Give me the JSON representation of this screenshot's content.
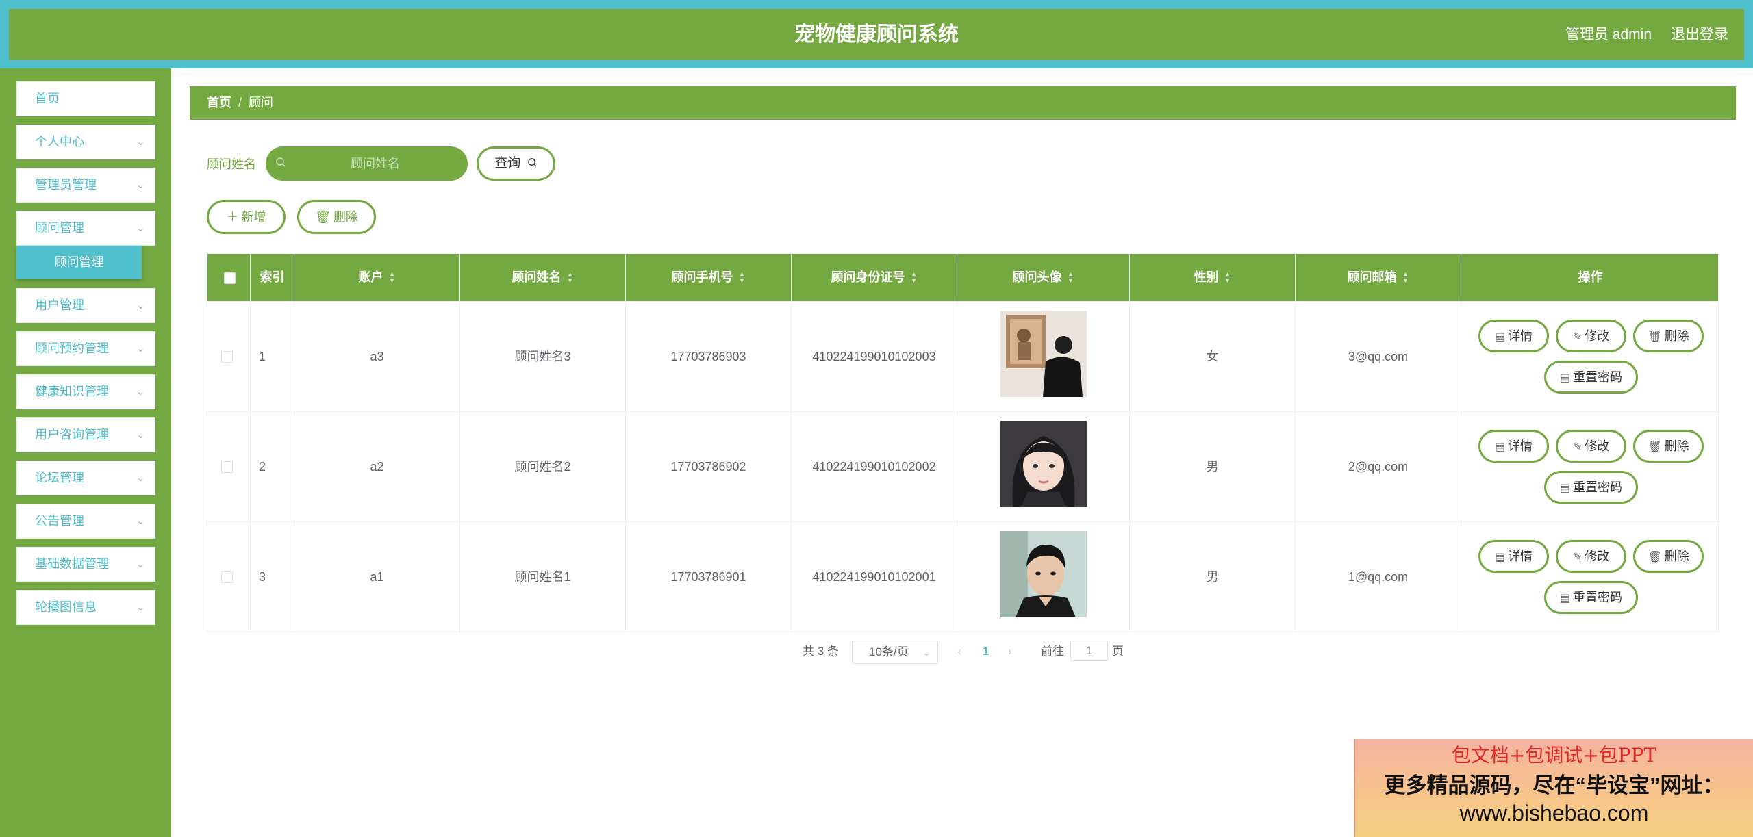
{
  "header": {
    "title": "宠物健康顾问系统",
    "user": "管理员 admin",
    "logout": "退出登录"
  },
  "sidebar": {
    "items": [
      {
        "label": "首页",
        "has_arrow": false
      },
      {
        "label": "个人中心",
        "has_arrow": true
      },
      {
        "label": "管理员管理",
        "has_arrow": true
      },
      {
        "label": "顾问管理",
        "has_arrow": true
      },
      {
        "label": "用户管理",
        "has_arrow": true
      },
      {
        "label": "顾问预约管理",
        "has_arrow": true
      },
      {
        "label": "健康知识管理",
        "has_arrow": true
      },
      {
        "label": "用户咨询管理",
        "has_arrow": true
      },
      {
        "label": "论坛管理",
        "has_arrow": true
      },
      {
        "label": "公告管理",
        "has_arrow": true
      },
      {
        "label": "基础数据管理",
        "has_arrow": true
      },
      {
        "label": "轮播图信息",
        "has_arrow": true
      }
    ],
    "active_submenu": "顾问管理"
  },
  "breadcrumb": {
    "home": "首页",
    "sep": "/",
    "current": "顾问"
  },
  "search": {
    "label": "顾问姓名",
    "placeholder": "顾问姓名",
    "value": "",
    "button": "查询"
  },
  "toolbar": {
    "add": "新增",
    "delete": "删除"
  },
  "table": {
    "columns": [
      "索引",
      "账户",
      "顾问姓名",
      "顾问手机号",
      "顾问身份证号",
      "顾问头像",
      "性别",
      "顾问邮箱",
      "操作"
    ],
    "rows": [
      {
        "index": "1",
        "account": "a3",
        "name": "顾问姓名3",
        "phone": "17703786903",
        "id_card": "410224199010102003",
        "avatar": "person-back-photo",
        "gender": "女",
        "email": "3@qq.com"
      },
      {
        "index": "2",
        "account": "a2",
        "name": "顾问姓名2",
        "phone": "17703786902",
        "id_card": "410224199010102002",
        "avatar": "girl-portrait-photo",
        "gender": "男",
        "email": "2@qq.com"
      },
      {
        "index": "3",
        "account": "a1",
        "name": "顾问姓名1",
        "phone": "17703786901",
        "id_card": "410224199010102001",
        "avatar": "man-portrait-photo",
        "gender": "男",
        "email": "1@qq.com"
      }
    ],
    "actions": {
      "detail": "详情",
      "edit": "修改",
      "delete": "删除",
      "reset": "重置密码"
    }
  },
  "pagination": {
    "total": "共 3 条",
    "page_size": "10条/页",
    "prev": "‹",
    "current_page": "1",
    "next": "›",
    "goto": "前往",
    "goto_value": "1",
    "page_unit": "页"
  },
  "watermark": {
    "line1": "包文档+包调试+包PPT",
    "line2": "更多精品源码，尽在“毕设宝”网址：",
    "line3": "www.bishebao.com"
  },
  "colors": {
    "primary": "#74a942",
    "accent": "#4fbfcb",
    "watermark_red": "#e02626"
  }
}
